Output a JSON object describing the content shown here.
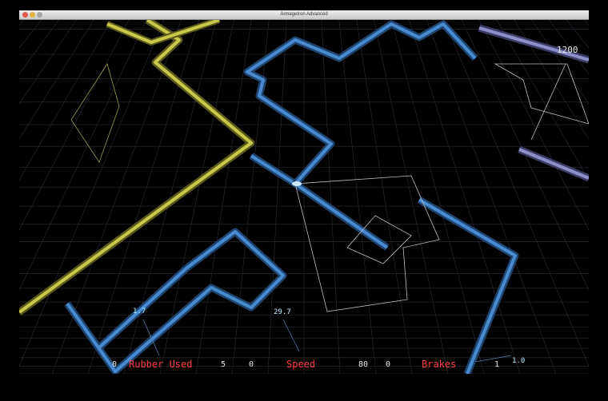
{
  "window": {
    "title": "Armagetron Advanced"
  },
  "colors": {
    "yellow_wall": "#c8c84a",
    "blue_wall": "#4a8ad0",
    "lavender_wall": "#8e8ec8",
    "grid": "#2c2c3a",
    "red_text": "#ff3d3d"
  },
  "hud": {
    "score": "1200",
    "rubber": {
      "label": "Rubber Used",
      "min": "0",
      "max": "5",
      "value": "1.7"
    },
    "speed": {
      "label": "Speed",
      "min": "0",
      "max": "80",
      "value": "29.7"
    },
    "brakes": {
      "label": "Brakes",
      "min": "0",
      "max": "1",
      "value": "1.0"
    }
  }
}
